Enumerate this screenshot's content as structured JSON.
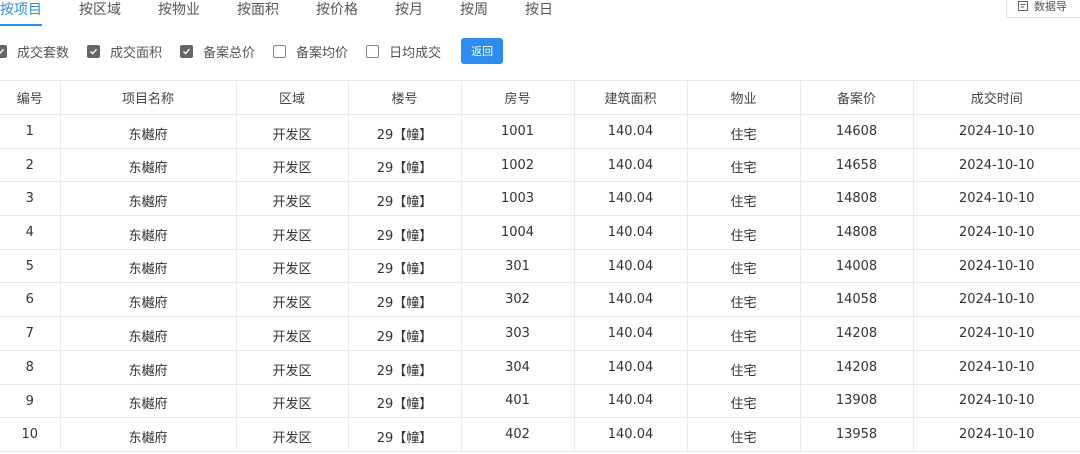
{
  "tabs": [
    {
      "label": "按项目",
      "active": true
    },
    {
      "label": "按区域",
      "active": false
    },
    {
      "label": "按物业",
      "active": false
    },
    {
      "label": "按面积",
      "active": false
    },
    {
      "label": "按价格",
      "active": false
    },
    {
      "label": "按月",
      "active": false
    },
    {
      "label": "按周",
      "active": false
    },
    {
      "label": "按日",
      "active": false
    }
  ],
  "export_label": "数据导",
  "checkboxes": [
    {
      "label": "成交套数",
      "checked": true
    },
    {
      "label": "成交面积",
      "checked": true
    },
    {
      "label": "备案总价",
      "checked": true
    },
    {
      "label": "备案均价",
      "checked": false
    },
    {
      "label": "日均成交",
      "checked": false
    }
  ],
  "back_label": "返回",
  "table": {
    "columns": [
      "编号",
      "项目名称",
      "区域",
      "楼号",
      "房号",
      "建筑面积",
      "物业",
      "备案价",
      "成交时间"
    ],
    "rows": [
      [
        "1",
        "东樾府",
        "开发区",
        "29【幢】",
        "1001",
        "140.04",
        "住宅",
        "14608",
        "2024-10-10"
      ],
      [
        "2",
        "东樾府",
        "开发区",
        "29【幢】",
        "1002",
        "140.04",
        "住宅",
        "14658",
        "2024-10-10"
      ],
      [
        "3",
        "东樾府",
        "开发区",
        "29【幢】",
        "1003",
        "140.04",
        "住宅",
        "14808",
        "2024-10-10"
      ],
      [
        "4",
        "东樾府",
        "开发区",
        "29【幢】",
        "1004",
        "140.04",
        "住宅",
        "14808",
        "2024-10-10"
      ],
      [
        "5",
        "东樾府",
        "开发区",
        "29【幢】",
        "301",
        "140.04",
        "住宅",
        "14008",
        "2024-10-10"
      ],
      [
        "6",
        "东樾府",
        "开发区",
        "29【幢】",
        "302",
        "140.04",
        "住宅",
        "14058",
        "2024-10-10"
      ],
      [
        "7",
        "东樾府",
        "开发区",
        "29【幢】",
        "303",
        "140.04",
        "住宅",
        "14208",
        "2024-10-10"
      ],
      [
        "8",
        "东樾府",
        "开发区",
        "29【幢】",
        "304",
        "140.04",
        "住宅",
        "14208",
        "2024-10-10"
      ],
      [
        "9",
        "东樾府",
        "开发区",
        "29【幢】",
        "401",
        "140.04",
        "住宅",
        "13908",
        "2024-10-10"
      ],
      [
        "10",
        "东樾府",
        "开发区",
        "29【幢】",
        "402",
        "140.04",
        "住宅",
        "13958",
        "2024-10-10"
      ]
    ]
  },
  "colors": {
    "accent": "#2d8cf0",
    "checked_box": "#666666",
    "border": "#e8eaec"
  },
  "icons": {
    "export": "export-file-icon",
    "check": "checkmark-icon"
  }
}
